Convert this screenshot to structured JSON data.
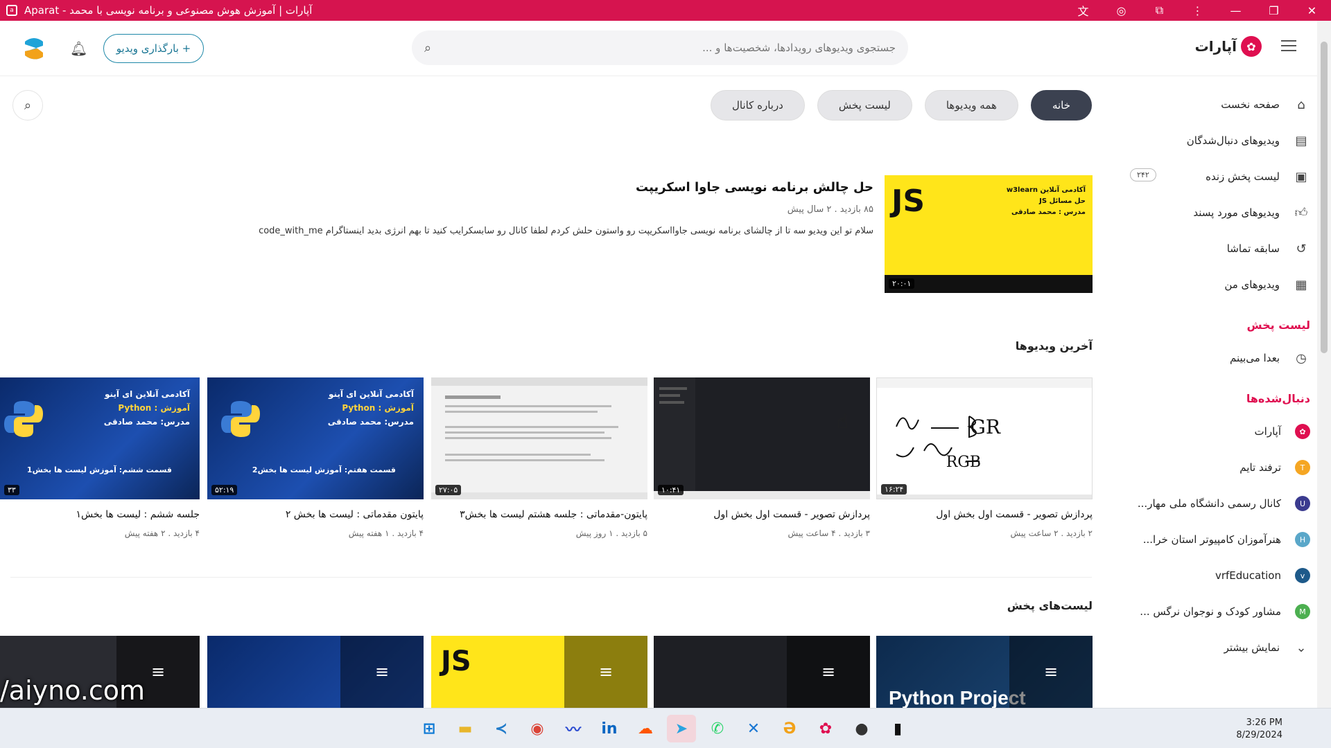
{
  "window": {
    "title": "آپارات | آموزش هوش مصنوعی و برنامه نویسی با محمد - Aparat"
  },
  "header": {
    "logo_text": "آپارات",
    "search_placeholder": "جستجوی ویدیوهای رویدادها، شخصیت‌ها و ...",
    "upload_label": "+ بارگذاری ویدیو"
  },
  "sidebar": {
    "items": [
      {
        "label": "صفحه نخست",
        "icon": "home-icon"
      },
      {
        "label": "ویدیوهای دنبال‌شدگان",
        "icon": "subscriptions-icon"
      },
      {
        "label": "لیست پخش زنده",
        "icon": "live-icon",
        "badge": "۲۴۲"
      },
      {
        "label": "ویدیوهای مورد پسند",
        "icon": "like-icon"
      },
      {
        "label": "سابقه تماشا",
        "icon": "history-icon"
      },
      {
        "label": "ویدیوهای من",
        "icon": "my-videos-icon"
      }
    ],
    "playlist_heading": "لیست پخش",
    "playlist_items": [
      {
        "label": "بعدا می‌بینم",
        "icon": "clock-icon"
      }
    ],
    "followed_heading": "دنبال‌شده‌ها",
    "followed": [
      {
        "label": "آپارات",
        "color": "#df0f50"
      },
      {
        "label": "ترفند تایم",
        "color": "#f5a623"
      },
      {
        "label": "کانال رسمی دانشگاه ملی مهار...",
        "color": "#3b3b8f"
      },
      {
        "label": "هنرآموزان کامپیوتر استان خرا...",
        "color": "#5aa7c9"
      },
      {
        "label": "vrfEducation",
        "color": "#1e5a8a"
      },
      {
        "label": "مشاور کودک و نوجوان نرگس ...",
        "color": "#4caf50"
      }
    ],
    "show_more": "نمایش بیشتر"
  },
  "tabs": [
    {
      "label": "خانه",
      "active": true
    },
    {
      "label": "همه ویدیوها",
      "active": false
    },
    {
      "label": "لیست پخش",
      "active": false
    },
    {
      "label": "درباره کانال",
      "active": false
    }
  ],
  "featured": {
    "title": "حل چالش برنامه نویسی جاوا اسکریپت",
    "meta": "۸۵ بازدید  .  ۲ سال پیش",
    "description": "سلام تو این ویدیو سه تا از چالشای برنامه نویسی جاوااسکریپت رو واستون حلش کردم لطفا کانال رو سابسکرایب کنید تا بهم انرژی بدید اینستاگرام code_with_me",
    "duration": "۲۰:۰۱",
    "thumb_js": "JS",
    "thumb_lines": [
      "آکادمی آنلاین w3learn",
      "حل مسائل JS",
      "مدرس : محمد صادقی"
    ]
  },
  "latest_heading": "آخرین ویدیوها",
  "videos": [
    {
      "title": "پردازش تصویر - قسمت اول بخش اول",
      "meta": "۲ بازدید  .  ۲ ساعت پیش",
      "duration": "۱۶:۲۴",
      "style": "white"
    },
    {
      "title": "پردازش تصویر - قسمت اول بخش اول",
      "meta": "۳ بازدید  .  ۴ ساعت پیش",
      "duration": "۱۰:۴۱",
      "style": "dark"
    },
    {
      "title": "پایتون-مقدماتی : جلسه هشتم لیست ها بخش۳",
      "meta": "۵ بازدید  .  ۱ روز پیش",
      "duration": "۲۷:۰۵",
      "style": "scr"
    },
    {
      "title": "پایتون مقدماتی : لیست ها بخش ۲",
      "meta": "۴ بازدید  .  ۱ هفته پیش",
      "duration": "۵۲:۱۹",
      "style": "py",
      "thumb_bottom": "قسمت هفتم: آموزش لیست ها بخش2"
    },
    {
      "title": "جلسه ششم : لیست ها بخش۱",
      "meta": "۴ بازدید  .  ۲ هفته پیش",
      "duration": "۳۳",
      "style": "py",
      "thumb_bottom": "قسمت ششم: آموزش لیست ها بخش1"
    }
  ],
  "py_thumb": {
    "line1": "آکادمی آنلاین  ای آینو",
    "line2": "آموزش : Python",
    "line3": "مدرس: محمد صادقی"
  },
  "playlists_heading": "لیست‌های پخش",
  "playlist_thumb_text": "Python Project",
  "clock": {
    "time": "3:26 PM",
    "date": "8/29/2024"
  },
  "watermark": "/aiyno.com",
  "colors": {
    "titlebar": "#d6144f",
    "accent": "#df0f50",
    "active_tab": "#3b4150"
  }
}
